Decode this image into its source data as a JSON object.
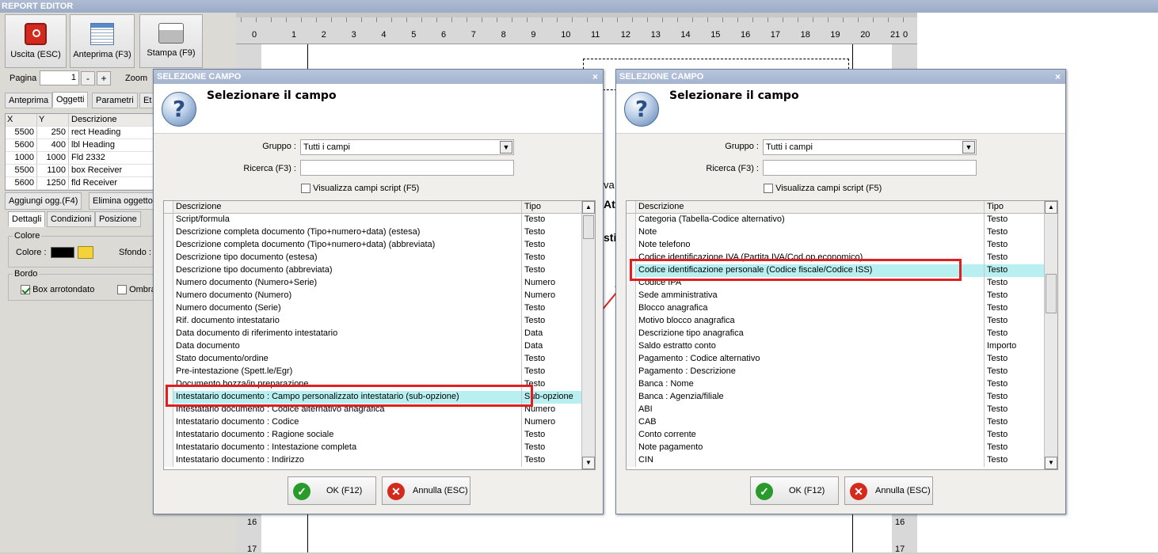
{
  "app_title": "REPORT EDITOR",
  "toolbar": {
    "exit_label": "Uscita (ESC)",
    "preview_label": "Anteprima (F3)",
    "print_label": "Stampa (F9)"
  },
  "page_bar": {
    "page_label": "Pagina",
    "page_value": "1",
    "minus": "-",
    "plus": "+",
    "zoom_label": "Zoom"
  },
  "tabs": [
    "Anteprima",
    "Oggetti",
    "Parametri",
    "Et"
  ],
  "objects_table": {
    "headers": [
      "X",
      "Y",
      "Descrizione"
    ],
    "rows": [
      [
        "5500",
        "250",
        "rect Heading"
      ],
      [
        "5600",
        "400",
        "lbl Heading"
      ],
      [
        "1000",
        "1000",
        "Fld 2332"
      ],
      [
        "5500",
        "1100",
        "box Receiver"
      ],
      [
        "5600",
        "1250",
        "fld Receiver"
      ]
    ]
  },
  "object_buttons": {
    "add": "Aggiungi ogg.(F4)",
    "delete": "Elimina oggetto"
  },
  "detail_tabs": [
    "Dettagli",
    "Condizioni",
    "Posizione"
  ],
  "colore_group": {
    "title": "Colore",
    "colore_label": "Colore :",
    "sfondo_label": "Sfondo :",
    "color_hex": "#000000"
  },
  "bordo_group": {
    "title": "Bordo",
    "rounded_label": "Box arrotondato",
    "shadow_label": "Ombra"
  },
  "ruler": {
    "h_ticks": [
      "0",
      "1",
      "2",
      "3",
      "4",
      "5",
      "6",
      "7",
      "8",
      "9",
      "10",
      "11",
      "12",
      "13",
      "14",
      "15",
      "16",
      "17",
      "18",
      "19",
      "20",
      "21",
      "0"
    ],
    "v_ticks": [
      "16",
      "17"
    ]
  },
  "paper_fragments": {
    "f1": "va",
    "f2": "Att",
    "f3": "sti"
  },
  "dialog_left": {
    "title": "SELEZIONE CAMPO",
    "close": "×",
    "heading": "Selezionare il campo",
    "gruppo_label": "Gruppo :",
    "gruppo_value": "Tutti i campi",
    "ricerca_label": "Ricerca (F3) :",
    "ricerca_value": "",
    "script_label": "Visualizza campi script (F5)",
    "col_desc": "Descrizione",
    "col_tipo": "Tipo",
    "rows": [
      [
        "Script/formula",
        "Testo"
      ],
      [
        "Descrizione completa documento (Tipo+numero+data) (estesa)",
        "Testo"
      ],
      [
        "Descrizione completa documento (Tipo+numero+data) (abbreviata)",
        "Testo"
      ],
      [
        "Descrizione tipo documento (estesa)",
        "Testo"
      ],
      [
        "Descrizione tipo documento (abbreviata)",
        "Testo"
      ],
      [
        "Numero documento (Numero+Serie)",
        "Numero"
      ],
      [
        "Numero documento (Numero)",
        "Numero"
      ],
      [
        "Numero documento (Serie)",
        "Testo"
      ],
      [
        "Rif. documento intestatario",
        "Testo"
      ],
      [
        "Data documento di riferimento intestatario",
        "Data"
      ],
      [
        "Data documento",
        "Data"
      ],
      [
        "Stato documento/ordine",
        "Testo"
      ],
      [
        "Pre-intestazione (Spett.le/Egr)",
        "Testo"
      ],
      [
        "Documento bozza/in preparazione",
        "Testo"
      ],
      [
        "Intestatario documento : Campo personalizzato intestatario (sub-opzione)",
        "Sub-opzione"
      ],
      [
        "Intestatario documento : Codice alternativo anagrafica",
        "Numero"
      ],
      [
        "Intestatario documento : Codice",
        "Numero"
      ],
      [
        "Intestatario documento : Ragione sociale",
        "Testo"
      ],
      [
        "Intestatario documento : Intestazione completa",
        "Testo"
      ],
      [
        "Intestatario documento : Indirizzo",
        "Testo"
      ]
    ],
    "selected_index": 14,
    "ok_label": "OK (F12)",
    "cancel_label": "Annulla (ESC)"
  },
  "dialog_right": {
    "title": "SELEZIONE CAMPO",
    "close": "×",
    "heading": "Selezionare il campo",
    "gruppo_label": "Gruppo :",
    "gruppo_value": "Tutti i campi",
    "ricerca_label": "Ricerca (F3) :",
    "ricerca_value": "",
    "script_label": "Visualizza campi script (F5)",
    "col_desc": "Descrizione",
    "col_tipo": "Tipo",
    "rows": [
      [
        "Categoria (Tabella-Codice alternativo)",
        "Testo"
      ],
      [
        "Note",
        "Testo"
      ],
      [
        "Note telefono",
        "Testo"
      ],
      [
        "Codice identificazione IVA (Partita IVA/Cod.op.economico)",
        "Testo"
      ],
      [
        "Codice identificazione personale (Codice fiscale/Codice ISS)",
        "Testo"
      ],
      [
        "Codice IPA",
        "Testo"
      ],
      [
        "Sede amministrativa",
        "Testo"
      ],
      [
        "Blocco anagrafica",
        "Testo"
      ],
      [
        "Motivo blocco anagrafica",
        "Testo"
      ],
      [
        "Descrizione tipo anagrafica",
        "Testo"
      ],
      [
        "Saldo estratto conto",
        "Importo"
      ],
      [
        "Pagamento : Codice alternativo",
        "Testo"
      ],
      [
        "Pagamento : Descrizione",
        "Testo"
      ],
      [
        "Banca : Nome",
        "Testo"
      ],
      [
        "Banca : Agenzia/filiale",
        "Testo"
      ],
      [
        "ABI",
        "Testo"
      ],
      [
        "CAB",
        "Testo"
      ],
      [
        "Conto corrente",
        "Testo"
      ],
      [
        "Note pagamento",
        "Testo"
      ],
      [
        "CIN",
        "Testo"
      ]
    ],
    "selected_index": 4,
    "ok_label": "OK (F12)",
    "cancel_label": "Annulla (ESC)"
  },
  "colors": {
    "highlight": "#e02020",
    "selected_row": "#b8f0f2",
    "title_bar": "#a4b4cf"
  }
}
